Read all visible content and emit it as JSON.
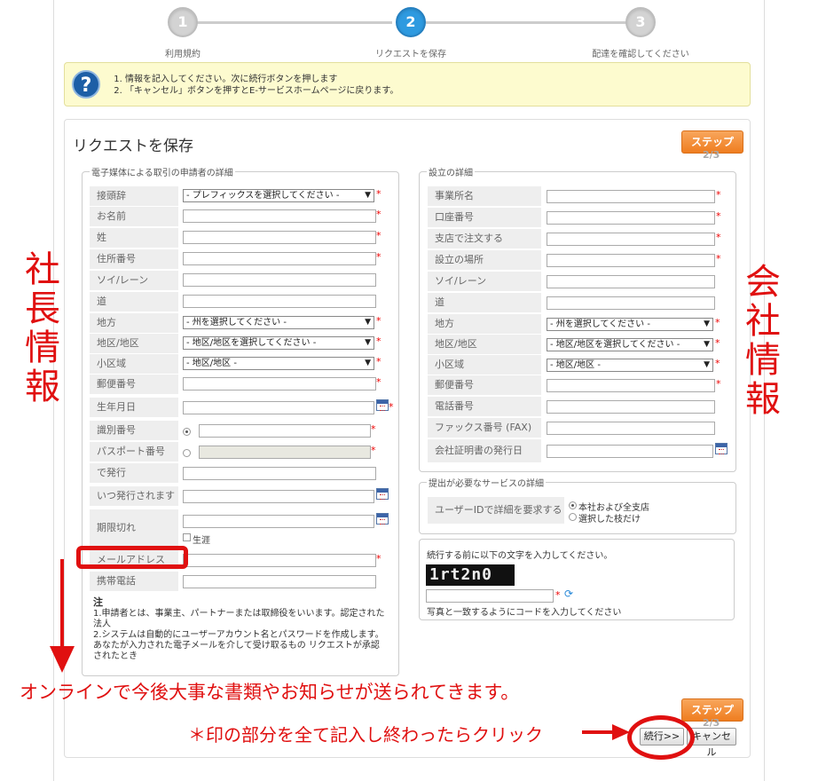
{
  "steps": [
    {
      "num": "1",
      "label": "利用規約"
    },
    {
      "num": "2",
      "label": "リクエストを保存"
    },
    {
      "num": "3",
      "label": "配達を確認してください"
    }
  ],
  "info": {
    "icon": "question-icon",
    "line1": "情報を記入してください。次に続行ボタンを押します",
    "line2": "「キャンセル」ボタンを押すとE-サービスホームページに戻ります。"
  },
  "panel": {
    "title": "リクエストを保存",
    "step_badge": "ステップ",
    "step_count": "2/3"
  },
  "applicant": {
    "legend": "電子媒体による取引の申請者の詳細",
    "prefix_label": "接頭辞",
    "prefix_select": "- プレフィックスを選択してください -",
    "name_label": "お名前",
    "surname_label": "姓",
    "address_no_label": "住所番号",
    "soi_label": "ソイ/レーン",
    "road_label": "道",
    "province_label": "地方",
    "province_select": "- 州を選択してください -",
    "district_label": "地区/地区",
    "district_select": "- 地区/地区を選択してください -",
    "subdistrict_label": "小区域",
    "subdistrict_select": "- 地区/地区 -",
    "postal_label": "郵便番号",
    "birth_label": "生年月日",
    "id_label": "識別番号",
    "passport_label": "パスポート番号",
    "issued_at_label": "で発行",
    "issued_when_label": "いつ発行されます",
    "expiry_label": "期限切れ",
    "lifetime_label": "生涯",
    "email_label": "メールアドレス",
    "mobile_label": "携帯電話"
  },
  "note": {
    "title": "注",
    "line1": "1.申請者とは、事業主、パートナーまたは取締役をいいます。認定された法人",
    "line2": "2.システムは自動的にユーザーアカウント名とパスワードを作成します。あなたが入力された電子メールを介して受け取るもの リクエストが承認されたとき"
  },
  "company": {
    "legend": "設立の詳細",
    "office_label": "事業所名",
    "account_label": "口座番号",
    "branch_label": "支店で注文する",
    "location_label": "設立の場所",
    "soi_label": "ソイ/レーン",
    "road_label": "道",
    "province_label": "地方",
    "province_select": "- 州を選択してください -",
    "district_label": "地区/地区",
    "district_select": "- 地区/地区を選択してください -",
    "subdistrict_label": "小区域",
    "subdistrict_select": "- 地区/地区 -",
    "postal_label": "郵便番号",
    "phone_label": "電話番号",
    "fax_label": "ファックス番号 (FAX)",
    "cert_date_label": "会社証明書の発行日"
  },
  "services": {
    "legend": "提出が必要なサービスの詳細",
    "userid_label": "ユーザーIDで詳細を要求する",
    "opt_all": "本社および全支店",
    "opt_selected": "選択した枝だけ"
  },
  "captcha": {
    "prompt": "続行する前に以下の文字を入力してください。",
    "code": "1rt2n0",
    "hint": "写真と一致するようにコードを入力してください"
  },
  "buttons": {
    "continue": "続行>>",
    "cancel": "キャンセル"
  },
  "annotations": {
    "left_vertical": "社長情報",
    "right_vertical": "会社情報",
    "email_note": "オンラインで今後大事な書類やお知らせが送られてきます。",
    "click_note": "＊印の部分を全て記入し終わったらクリック"
  },
  "colors": {
    "required": "#e00000",
    "annotation": "#e01010",
    "step_active": "#2e9ae0",
    "step_badge": "#ef7d1f",
    "info_bg": "#fdfbcf"
  }
}
